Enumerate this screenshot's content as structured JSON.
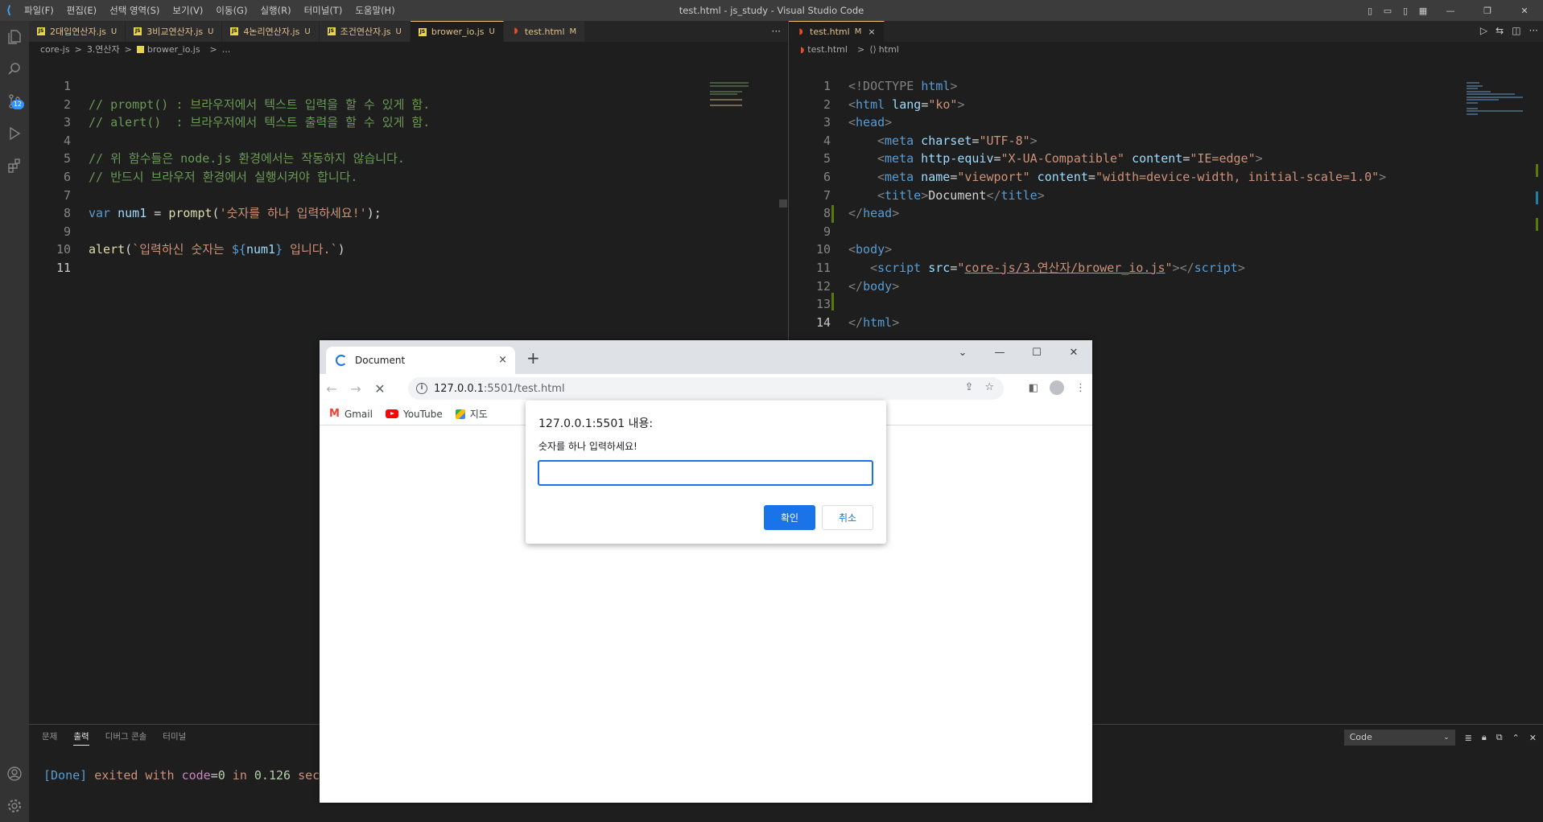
{
  "window_title": "test.html - js_study - Visual Studio Code",
  "menu": [
    "파일(F)",
    "편집(E)",
    "선택 영역(S)",
    "보기(V)",
    "이동(G)",
    "실행(R)",
    "터미널(T)",
    "도움말(H)"
  ],
  "activity": {
    "scm_badge": "12"
  },
  "left_editor": {
    "tabs": [
      {
        "label": "2대입연산자.js",
        "status": "U"
      },
      {
        "label": "3비교연산자.js",
        "status": "U"
      },
      {
        "label": "4논리연산자.js",
        "status": "U"
      },
      {
        "label": "조건연산자.js",
        "status": "U"
      },
      {
        "label": "brower_io.js",
        "status": "U"
      },
      {
        "label": "test.html",
        "status": "M"
      }
    ],
    "more": "···",
    "breadcrumb": [
      "core-js",
      ">",
      "3.연산자",
      ">",
      "brower_io.js",
      ">",
      "..."
    ],
    "line_numbers": [
      "1",
      "2",
      "3",
      "4",
      "5",
      "6",
      "7",
      "8",
      "9",
      "10",
      "11"
    ],
    "lines": {
      "l2": "// prompt() : 브라우저에서 텍스트 입력을 할 수 있게 함.",
      "l3": "// alert()  : 브라우저에서 텍스트 출력을 할 수 있게 함.",
      "l5": "// 위 함수들은 node.js 환경에서는 작동하지 않습니다.",
      "l6": "// 반드시 브라우저 환경에서 실행시켜야 합니다.",
      "l8_kw": "var",
      "l8_var": "num1",
      "l8_eq": " = ",
      "l8_fn": "prompt",
      "l8_open": "(",
      "l8_str": "'숫자를 하나 입력하세요!'",
      "l8_close": ");",
      "l10_fn": "alert",
      "l10_open": "(",
      "l10_str1": "`입력하신 숫자는 ",
      "l10_tpl_open": "${",
      "l10_var": "num1",
      "l10_tpl_close": "}",
      "l10_str2": " 입니다.`",
      "l10_close": ")"
    }
  },
  "right_editor": {
    "tab": {
      "label": "test.html",
      "status": "M",
      "close": "×"
    },
    "breadcrumb": [
      "test.html",
      ">",
      "html"
    ],
    "line_numbers": [
      "1",
      "2",
      "3",
      "4",
      "5",
      "6",
      "7",
      "8",
      "9",
      "10",
      "11",
      "12",
      "13",
      "14"
    ],
    "code": {
      "l1a": "<!DOCTYPE ",
      "l1b": "html",
      "l1c": ">",
      "l2a": "<",
      "l2b": "html",
      "l2c": " lang",
      "l2d": "=",
      "l2e": "\"ko\"",
      "l2f": ">",
      "l3a": "<",
      "l3b": "head",
      "l3c": ">",
      "l4a": "<",
      "l4b": "meta",
      "l4c": " charset",
      "l4d": "=",
      "l4e": "\"UTF-8\"",
      "l4f": ">",
      "l5a": "<",
      "l5b": "meta",
      "l5c": " http-equiv",
      "l5d": "=",
      "l5e": "\"X-UA-Compatible\"",
      "l5g": " content",
      "l5h": "=",
      "l5i": "\"IE=edge\"",
      "l5f": ">",
      "l6a": "<",
      "l6b": "meta",
      "l6c": " name",
      "l6d": "=",
      "l6e": "\"viewport\"",
      "l6g": " content",
      "l6h": "=",
      "l6i": "\"width=device-width, initial-scale=1.0\"",
      "l6f": ">",
      "l7a": "<",
      "l7b": "title",
      "l7c": ">",
      "l7d": "Document",
      "l7e": "</",
      "l7f": "title",
      "l7g": ">",
      "l8a": "</",
      "l8b": "head",
      "l8c": ">",
      "l10a": "<",
      "l10b": "body",
      "l10c": ">",
      "l11a": "<",
      "l11b": "script",
      "l11c": " src",
      "l11d": "=",
      "l11e": "\"",
      "l11u": "core-js/3.연산자/brower_io.js",
      "l11q": "\"",
      "l11f": "></",
      "l11g": "script",
      "l11h": ">",
      "l12a": "</",
      "l12b": "body",
      "l12c": ">",
      "l14a": "</",
      "l14b": "html",
      "l14c": ">"
    }
  },
  "panel": {
    "tabs": [
      "문제",
      "출력",
      "디버그 콘솔",
      "터미널"
    ],
    "selected_tab": "출력",
    "output_channel": "Code",
    "output": {
      "done": "[Done]",
      "exited": " exited with ",
      "code_key": "code",
      "eq": "=",
      "code_val": "0",
      "in": " in ",
      "secs": "0.126",
      "tail": " sec"
    }
  },
  "browser": {
    "tab_title": "Document",
    "tab_close": "×",
    "new_tab": "+",
    "url_host": "127.0.0.1",
    "url_path": ":5501/test.html",
    "bookmarks": [
      "Gmail",
      "YouTube",
      "지도"
    ]
  },
  "dialog": {
    "title": "127.0.0.1:5501 내용:",
    "message": "숫자를 하나 입력하세요!",
    "input_value": "",
    "ok_label": "확인",
    "cancel_label": "취소"
  }
}
